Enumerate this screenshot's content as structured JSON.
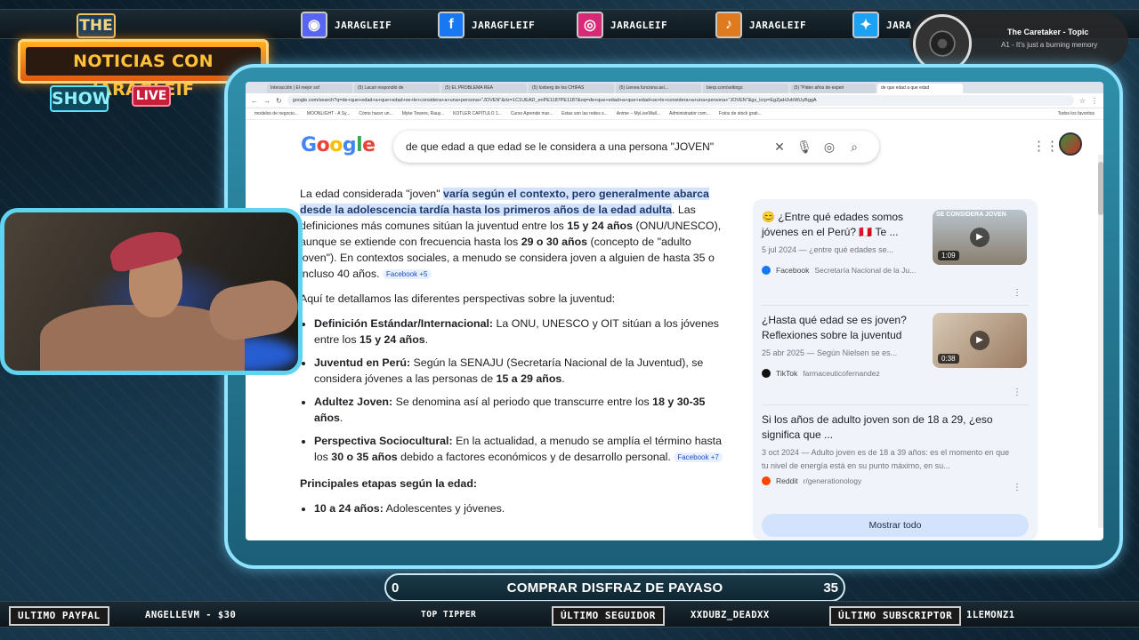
{
  "socials": [
    {
      "icon": "discord-icon",
      "glyph": "◉",
      "bg": "#5865f2",
      "name": "JARAGLEIF"
    },
    {
      "icon": "facebook-icon",
      "glyph": "f",
      "bg": "#1877f2",
      "name": "JARAGFLEIF"
    },
    {
      "icon": "instagram-icon",
      "glyph": "◎",
      "bg": "#d62976",
      "name": "JARAGLEIF"
    },
    {
      "icon": "tiktok-icon",
      "glyph": "♪",
      "bg": "#e07a1f",
      "name": "JARAGLEIF"
    },
    {
      "icon": "twitter-icon",
      "glyph": "✦",
      "bg": "#1da1f2",
      "name": "JARA"
    }
  ],
  "logo": {
    "the": "THE",
    "main": "NOTICIAS CON JARAGLEIF",
    "show": "SHOW",
    "live": "LIVE"
  },
  "now_playing": {
    "title": "The Caretaker - Topic",
    "subtitle": "A1 - It's just a burning memory"
  },
  "browser": {
    "tabs": [
      "Interacción | El mejor sof",
      "(5) Lacari respondió de",
      "(5) EL PROBLEMA REA",
      "(5) Iceberg de los CHIFAS",
      "(5) Lienea funciona así...",
      "bierp.com/settings",
      "(5) \"Piden años de experi",
      "de que edad a que edad"
    ],
    "url": "google.com/search?q=de+que+edad+a+que+edad+se+le+considera+a+una+persona+\"JOVEN\"&rlz=1C1UEAD_enPE1187PE1187&oq=de+que+edad+a+que+edad+se+le+considera+a+una+persona+\"JOVEN\"&gs_lcrp=EgZjaHJvbWUyBggA",
    "bookmarks": [
      "modelos de negocio...",
      "MOONLIGHT - A Sy...",
      "Cómo hacer un...",
      "Myke Towers, Rauy...",
      "KOTLER CAPÍTULO 1...",
      "Curso Aprende mar...",
      "Estas son las redes s...",
      "Anime – MyLiveWall...",
      "Administrador com...",
      "Fotos de stock grati..."
    ],
    "all_bookmarks": "Todos los favoritos"
  },
  "search": {
    "logo": "Google",
    "query": "de que edad a que edad se le considera a una persona \"JOVEN\""
  },
  "answer": {
    "p1_a": "La edad considerada \"joven\" ",
    "p1_hl": "varía según el contexto, pero generalmente abarca desde la adolescencia tardía hasta los primeros años de la edad adulta",
    "p1_b": ". Las definiciones más comunes sitúan la juventud entre los ",
    "p1_b1": "15 y 24 años",
    "p1_c": " (ONU/UNESCO), aunque se extiende con frecuencia hasta los ",
    "p1_c1": "29 o 30 años",
    "p1_d": " (concepto de \"adulto joven\"). En contextos sociales, a menudo se considera joven a alguien de hasta 35 o incluso 40 años.",
    "chip1": "Facebook +5",
    "p2": "Aquí te detallamos las diferentes perspectivas sobre la juventud:",
    "items": [
      {
        "b": "Definición Estándar/Internacional:",
        "t": " La ONU, UNESCO y OIT sitúan a los jóvenes entre los ",
        "b2": "15 y 24 años",
        "t2": "."
      },
      {
        "b": "Juventud en Perú:",
        "t": " Según la SENAJU (Secretaría Nacional de la Juventud), se considera jóvenes a las personas de ",
        "b2": "15 a 29 años",
        "t2": "."
      },
      {
        "b": "Adultez Joven:",
        "t": " Se denomina así al periodo que transcurre entre los ",
        "b2": "18 y 30-35 años",
        "t2": "."
      },
      {
        "b": "Perspectiva Sociocultural:",
        "t": " En la actualidad, a menudo se amplía el término hasta los ",
        "b2": "30 o 35 años",
        "t2": " debido a factores económicos y de desarrollo personal."
      }
    ],
    "chip2": "Facebook +7",
    "stages_title": "Principales etapas según la edad:",
    "stage1_b": "10 a 24 años:",
    "stage1_t": " Adolescentes y jóvenes."
  },
  "cards": [
    {
      "title": "😊 ¿Entre qué edades somos jóvenes en el Perú? 🇵🇪 Te ...",
      "date": "5 jul 2024 — ¿entre qué edades se...",
      "source": "Facebook",
      "author": "Secretaría Nacional de la Ju...",
      "duration": "1:09",
      "thumb_text": "SE CONSIDERA JOVEN"
    },
    {
      "title": "¿Hasta qué edad se es joven? Reflexiones sobre la juventud",
      "date": "25 abr 2025 — Según Nielsen se es...",
      "source": "TikTok",
      "author": "farmaceuticofernandez",
      "duration": "0:38"
    },
    {
      "title": "Si los años de adulto joven son de 18 a 29, ¿eso significa que ...",
      "date": "3 oct 2024 — Adulto joven es de 18 a 39 años: es el momento en que tu nivel de energía está en su punto máximo, en su...",
      "source": "Reddit",
      "author": "r/generationology"
    }
  ],
  "show_all": "Mostrar todo",
  "goal": {
    "start": "0",
    "title": "COMPRAR DISFRAZ DE PAYASO",
    "end": "35",
    "progress": 0
  },
  "bottom": {
    "paypal_label": "ULTIMO PAYPAL",
    "paypal_value": "ANGELLEVM - $30",
    "tipper_label": "TOP TIPPER",
    "follower_label": "ÚLTIMO SEGUIDOR",
    "follower_value": "XXDUBZ_DEADXX",
    "sub_label": "ÚLTIMO SUBSCRIPTOR",
    "sub_value": "1LEMONZ1"
  },
  "colors": {
    "accent": "#5fd4f0",
    "logo_orange": "#ff9a1f",
    "highlight": "#d3e3fd"
  }
}
